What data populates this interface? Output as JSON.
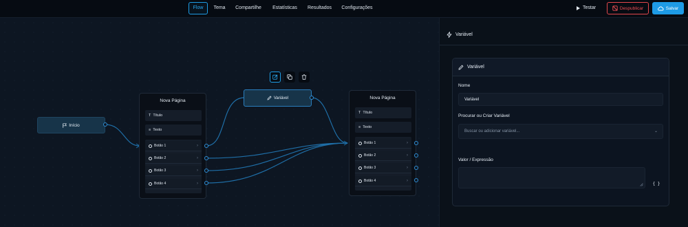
{
  "header": {
    "tabs": [
      "Flow",
      "Tema",
      "Compartilhe",
      "Estatísticas",
      "Resultados",
      "Configurações"
    ],
    "active_tab": "Flow",
    "test_label": "Testar",
    "unpublish_label": "Despublicar",
    "save_label": "Salvar",
    "colors": {
      "accent": "#1e9de6",
      "danger": "#e5484d"
    }
  },
  "canvas": {
    "start_node": {
      "label": "Início"
    },
    "page_node_1": {
      "title": "Nova Página",
      "components": [
        "Título",
        "Texto"
      ],
      "buttons": [
        "Botão 1",
        "Botão 2",
        "Botão 3",
        "Botão 4"
      ]
    },
    "variable_node": {
      "label": "Variável"
    },
    "page_node_2": {
      "title": "Nova Página",
      "components": [
        "Título",
        "Texto"
      ],
      "buttons": [
        "Botão 1",
        "Botão 2",
        "Botão 3",
        "Botão 4"
      ]
    },
    "node_toolbar": [
      "edit-icon",
      "copy-icon",
      "trash-icon"
    ]
  },
  "panel": {
    "title": "Variável",
    "card_title": "Variável",
    "name_label": "Nome",
    "name_value": "Variável",
    "search_label": "Procurar ou Criar Variável",
    "search_placeholder": "Buscar ou adicionar variável...",
    "value_label": "Valor / Expressão",
    "value_value": "",
    "braces_label": "{ }"
  }
}
